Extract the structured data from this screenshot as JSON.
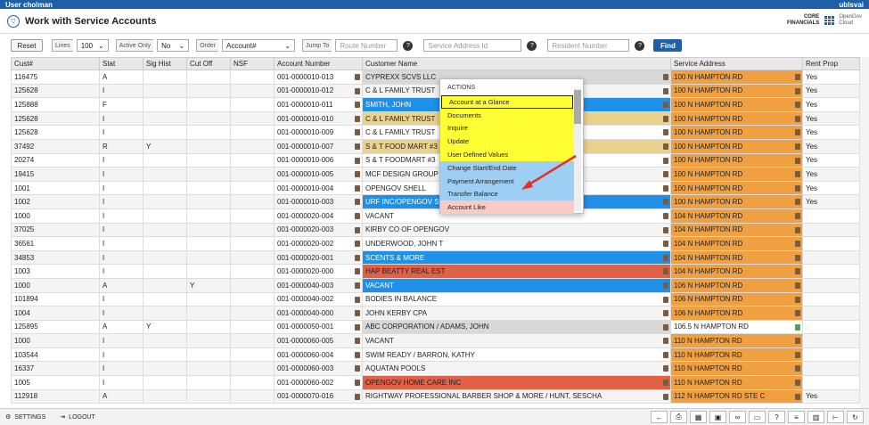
{
  "app": {
    "user": "User cholman",
    "server": "ublsvai",
    "title": "Work with Service Accounts",
    "brand_core": "CORE",
    "brand_fin": "FINANCIALS",
    "brand_og": "OpenGov",
    "brand_cloud": "Cloud"
  },
  "toolbar": {
    "reset": "Reset",
    "lines_label": "Lines",
    "lines_value": "100",
    "active_label": "Active Only",
    "active_value": "No",
    "order_label": "Order",
    "order_value": "Account#",
    "jump_label": "Jump To",
    "route_placeholder": "Route Number",
    "service_placeholder": "Service Address Id",
    "resident_placeholder": "Resident Number",
    "find": "Find"
  },
  "columns": [
    "Cust#",
    "Stat",
    "Sig Hist",
    "Cut Off",
    "NSF",
    "Account Number",
    "Customer Name",
    "Service Address",
    "Rent Prop"
  ],
  "rows": [
    {
      "cust": "116475",
      "stat": "A",
      "sig": "",
      "cut": "",
      "nsf": "",
      "acct": "001-0000010-013",
      "name": "CYPREXX SCVS LLC",
      "nc": "gr",
      "addr": "100 N HAMPTON RD",
      "ac": "or",
      "rent": "Yes"
    },
    {
      "cust": "125628",
      "stat": "I",
      "sig": "",
      "cut": "",
      "nsf": "",
      "acct": "001-0000010-012",
      "name": "C & L FAMILY TRUST",
      "nc": "",
      "addr": "100 N HAMPTON RD",
      "ac": "or",
      "rent": "Yes"
    },
    {
      "cust": "125888",
      "stat": "F",
      "sig": "",
      "cut": "",
      "nsf": "",
      "acct": "001-0000010-011",
      "name": "SMITH, JOHN",
      "nc": "bl",
      "addr": "100 N HAMPTON RD",
      "ac": "or",
      "rent": "Yes"
    },
    {
      "cust": "125628",
      "stat": "I",
      "sig": "",
      "cut": "",
      "nsf": "",
      "acct": "001-0000010-010",
      "name": "C & L FAMILY TRUST",
      "nc": "ye",
      "addr": "100 N HAMPTON RD",
      "ac": "or",
      "rent": "Yes"
    },
    {
      "cust": "125628",
      "stat": "I",
      "sig": "",
      "cut": "",
      "nsf": "",
      "acct": "001-0000010-009",
      "name": "C & L FAMILY TRUST",
      "nc": "",
      "addr": "100 N HAMPTON RD",
      "ac": "or",
      "rent": "Yes"
    },
    {
      "cust": "37492",
      "stat": "R",
      "sig": "Y",
      "cut": "",
      "nsf": "",
      "acct": "001-0000010-007",
      "name": "S & T FOOD MART #3",
      "nc": "ye",
      "addr": "100 N HAMPTON RD",
      "ac": "or",
      "rent": "Yes"
    },
    {
      "cust": "20274",
      "stat": "I",
      "sig": "",
      "cut": "",
      "nsf": "",
      "acct": "001-0000010-006",
      "name": "S & T FOODMART #3",
      "nc": "",
      "addr": "100 N HAMPTON RD",
      "ac": "or",
      "rent": "Yes"
    },
    {
      "cust": "19415",
      "stat": "I",
      "sig": "",
      "cut": "",
      "nsf": "",
      "acct": "001-0000010-005",
      "name": "MCF DESIGN GROUP",
      "nc": "",
      "addr": "100 N HAMPTON RD",
      "ac": "or",
      "rent": "Yes"
    },
    {
      "cust": "1001",
      "stat": "I",
      "sig": "",
      "cut": "",
      "nsf": "",
      "acct": "001-0000010-004",
      "name": "OPENGOV SHELL",
      "nc": "",
      "addr": "100 N HAMPTON RD",
      "ac": "or",
      "rent": "Yes"
    },
    {
      "cust": "1002",
      "stat": "I",
      "sig": "",
      "cut": "",
      "nsf": "",
      "acct": "001-0000010-003",
      "name": "URF INC/OPENGOV S",
      "nc": "bl",
      "addr": "100 N HAMPTON RD",
      "ac": "or",
      "rent": "Yes"
    },
    {
      "cust": "1000",
      "stat": "I",
      "sig": "",
      "cut": "",
      "nsf": "",
      "acct": "001-0000020-004",
      "name": "VACANT",
      "nc": "",
      "addr": "104 N HAMPTON RD",
      "ac": "or",
      "rent": ""
    },
    {
      "cust": "37025",
      "stat": "I",
      "sig": "",
      "cut": "",
      "nsf": "",
      "acct": "001-0000020-003",
      "name": "KIRBY CO OF OPENGOV",
      "nc": "",
      "addr": "104 N HAMPTON RD",
      "ac": "or",
      "rent": ""
    },
    {
      "cust": "36561",
      "stat": "I",
      "sig": "",
      "cut": "",
      "nsf": "",
      "acct": "001-0000020-002",
      "name": "UNDERWOOD, JOHN T",
      "nc": "",
      "addr": "104 N HAMPTON RD",
      "ac": "or",
      "rent": ""
    },
    {
      "cust": "34853",
      "stat": "I",
      "sig": "",
      "cut": "",
      "nsf": "",
      "acct": "001-0000020-001",
      "name": "SCENTS & MORE",
      "nc": "bl",
      "addr": "104 N HAMPTON RD",
      "ac": "or",
      "rent": ""
    },
    {
      "cust": "1003",
      "stat": "I",
      "sig": "",
      "cut": "",
      "nsf": "",
      "acct": "001-0000020-000",
      "name": "HAP BEATTY REAL EST",
      "nc": "rd",
      "addr": "104 N HAMPTON RD",
      "ac": "or",
      "rent": ""
    },
    {
      "cust": "1000",
      "stat": "A",
      "sig": "",
      "cut": "Y",
      "nsf": "",
      "acct": "001-0000040-003",
      "name": "VACANT",
      "nc": "bl",
      "addr": "106 N HAMPTON RD",
      "ac": "or",
      "rent": ""
    },
    {
      "cust": "101894",
      "stat": "I",
      "sig": "",
      "cut": "",
      "nsf": "",
      "acct": "001-0000040-002",
      "name": "BODIES IN BALANCE",
      "nc": "",
      "addr": "106 N HAMPTON RD",
      "ac": "or",
      "rent": ""
    },
    {
      "cust": "1004",
      "stat": "I",
      "sig": "",
      "cut": "",
      "nsf": "",
      "acct": "001-0000040-000",
      "name": "JOHN KERBY CPA",
      "nc": "",
      "addr": "106 N HAMPTON RD",
      "ac": "or",
      "rent": ""
    },
    {
      "cust": "125895",
      "stat": "A",
      "sig": "Y",
      "cut": "",
      "nsf": "",
      "acct": "001-0000050-001",
      "name": "ABC CORPORATION / ADAMS, JOHN",
      "nc": "gr",
      "addr": "106.5 N HAMPTON RD",
      "ac": "",
      "rent": ""
    },
    {
      "cust": "1000",
      "stat": "I",
      "sig": "",
      "cut": "",
      "nsf": "",
      "acct": "001-0000060-005",
      "name": "VACANT",
      "nc": "",
      "addr": "110 N HAMPTON RD",
      "ac": "or",
      "rent": ""
    },
    {
      "cust": "103544",
      "stat": "I",
      "sig": "",
      "cut": "",
      "nsf": "",
      "acct": "001-0000060-004",
      "name": "SWIM READY / BARRON, KATHY",
      "nc": "",
      "addr": "110 N HAMPTON RD",
      "ac": "or",
      "rent": ""
    },
    {
      "cust": "16337",
      "stat": "I",
      "sig": "",
      "cut": "",
      "nsf": "",
      "acct": "001-0000060-003",
      "name": "AQUATAN POOLS",
      "nc": "",
      "addr": "110 N HAMPTON RD",
      "ac": "or",
      "rent": ""
    },
    {
      "cust": "1005",
      "stat": "I",
      "sig": "",
      "cut": "",
      "nsf": "",
      "acct": "001-0000060-002",
      "name": "OPENGOV HOME CARE INC",
      "nc": "rd",
      "addr": "110 N HAMPTON RD",
      "ac": "or",
      "rent": ""
    },
    {
      "cust": "112918",
      "stat": "A",
      "sig": "",
      "cut": "",
      "nsf": "",
      "acct": "001-0000070-016",
      "name": "RIGHTWAY PROFESSIONAL BARBER SHOP & MORE / HUNT, SESCHA",
      "nc": "",
      "addr": "112 N HAMPTON RD STE C",
      "ac": "or",
      "rent": "Yes"
    }
  ],
  "actions": {
    "title": "ACTIONS",
    "items": [
      {
        "label": "Account at a Glance",
        "c": "y"
      },
      {
        "label": "Documents",
        "c": "y"
      },
      {
        "label": "Inquire",
        "c": "y"
      },
      {
        "label": "Update",
        "c": "y"
      },
      {
        "label": "User Defined Values",
        "c": "y"
      },
      {
        "label": "Change Start/End Date",
        "c": "b"
      },
      {
        "label": "Payment Arrangement",
        "c": "b"
      },
      {
        "label": "Transfer Balance",
        "c": "b"
      },
      {
        "label": "Account Like",
        "c": "p"
      }
    ]
  },
  "footer": {
    "settings": "SETTINGS",
    "logout": "LOGOUT"
  },
  "footer_icons": [
    "back-icon",
    "print-icon",
    "grid-icon",
    "excel-icon",
    "binoculars-icon",
    "chat-icon",
    "help-icon",
    "list-icon",
    "calendar-icon",
    "tree-icon",
    "refresh-icon"
  ]
}
